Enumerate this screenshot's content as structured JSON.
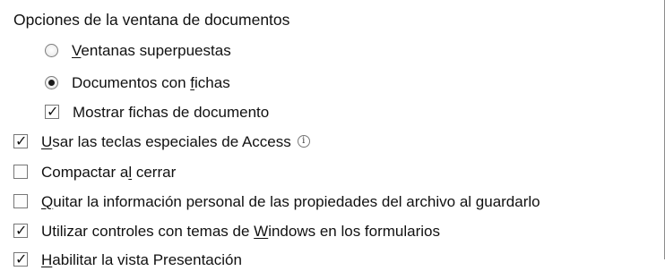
{
  "section": {
    "title": "Opciones de la ventana de documentos"
  },
  "window_options": {
    "radio1_prefix": "",
    "radio1_mnemonic": "V",
    "radio1_suffix": "entanas superpuestas",
    "radio2_prefix": "Documentos con ",
    "radio2_mnemonic": "f",
    "radio2_suffix": "ichas",
    "checkbox_label": "Mostrar fichas de documento"
  },
  "options": {
    "access_keys_prefix": "",
    "access_keys_mnemonic": "U",
    "access_keys_suffix": "sar las teclas especiales de Access",
    "compact_prefix": "Compactar a",
    "compact_mnemonic": "l",
    "compact_suffix": " cerrar",
    "remove_info_prefix": "",
    "remove_info_mnemonic": "Q",
    "remove_info_suffix": "uitar la información personal de las propiedades del archivo al guardarlo",
    "themes_prefix": "Utilizar controles con temas de ",
    "themes_mnemonic": "W",
    "themes_suffix": "indows en los formularios",
    "layout_prefix": "",
    "layout_mnemonic": "H",
    "layout_suffix": "abilitar la vista Presentación"
  },
  "states": {
    "radio_overlapping": false,
    "radio_tabbed": true,
    "show_document_tabs": true,
    "use_access_special_keys": true,
    "compact_on_close": false,
    "remove_personal_info": false,
    "use_windows_themed_controls": true,
    "enable_layout_view": true
  },
  "icons": {
    "info": "info-icon"
  }
}
